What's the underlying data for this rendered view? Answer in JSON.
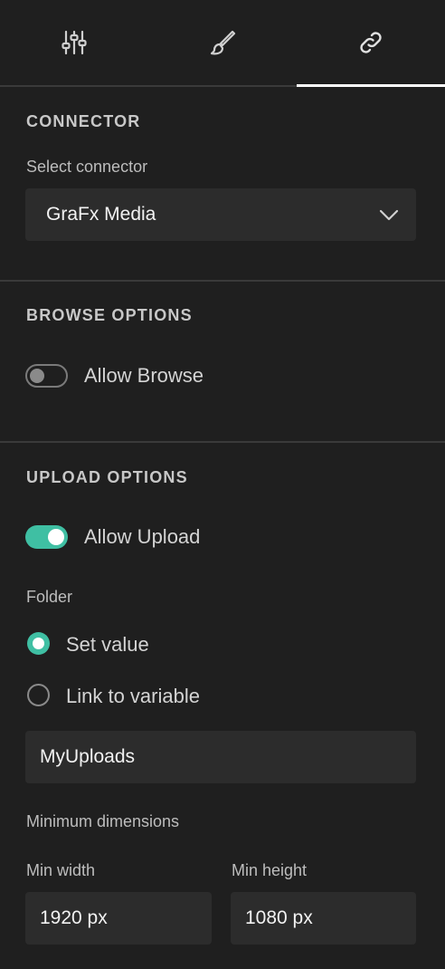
{
  "tabs": [
    {
      "icon": "sliders-icon",
      "active": false
    },
    {
      "icon": "brush-icon",
      "active": false
    },
    {
      "icon": "link-icon",
      "active": true
    }
  ],
  "connector": {
    "title": "CONNECTOR",
    "select_label": "Select connector",
    "selected_value": "GraFx Media"
  },
  "browse": {
    "title": "BROWSE OPTIONS",
    "allow_browse_label": "Allow Browse",
    "allow_browse": false
  },
  "upload": {
    "title": "UPLOAD OPTIONS",
    "allow_upload_label": "Allow Upload",
    "allow_upload": true,
    "folder_label": "Folder",
    "radio_set_value": "Set value",
    "radio_link_variable": "Link to variable",
    "selected_radio": "set_value",
    "folder_value": "MyUploads",
    "min_dimensions_label": "Minimum dimensions",
    "min_width_label": "Min width",
    "min_width_value": "1920 px",
    "min_height_label": "Min height",
    "min_height_value": "1080 px"
  },
  "colors": {
    "accent": "#3fbfa3",
    "background": "#1f1f1f",
    "field": "#2c2c2c"
  }
}
